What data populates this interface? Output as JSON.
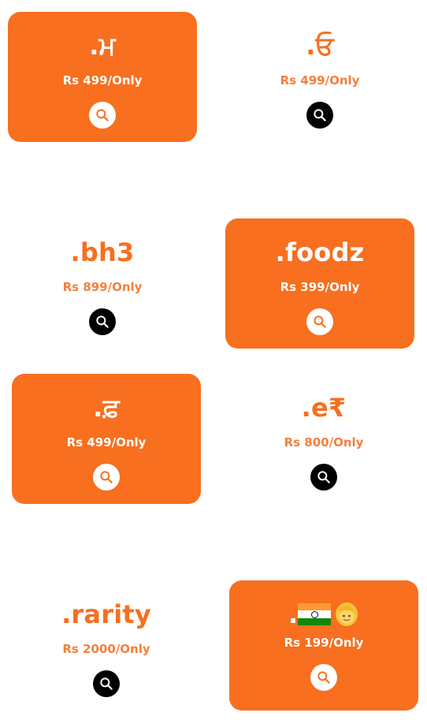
{
  "cards": [
    {
      "tld": ".ਮ",
      "price": "Rs 499/Only"
    },
    {
      "tld": ".ਓ",
      "price": "Rs 499/Only"
    },
    {
      "tld": ".bh3",
      "price": "Rs 899/Only"
    },
    {
      "tld": ".foodz",
      "price": "Rs 399/Only"
    },
    {
      "tld": ".ਫ਼",
      "price": "Rs 499/Only"
    },
    {
      "tld": ".e₹",
      "price": "Rs 800/Only"
    },
    {
      "tld": ".rarity",
      "price": "Rs 2000/Only"
    },
    {
      "tld": ".",
      "tld_emoji": [
        "indian-flag",
        "person-emoji"
      ],
      "price": "Rs 199/Only"
    }
  ],
  "icons": {
    "search": "search-icon"
  },
  "colors": {
    "accent": "#f76f1f",
    "white": "#ffffff",
    "black": "#000000"
  }
}
